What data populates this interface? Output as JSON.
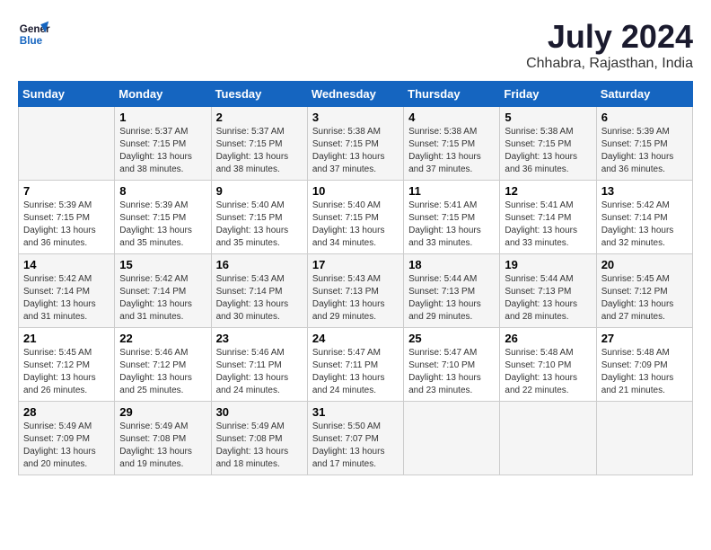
{
  "logo": {
    "line1": "General",
    "line2": "Blue"
  },
  "title": "July 2024",
  "subtitle": "Chhabra, Rajasthan, India",
  "headers": [
    "Sunday",
    "Monday",
    "Tuesday",
    "Wednesday",
    "Thursday",
    "Friday",
    "Saturday"
  ],
  "weeks": [
    [
      {
        "day": "",
        "sunrise": "",
        "sunset": "",
        "daylight": ""
      },
      {
        "day": "1",
        "sunrise": "Sunrise: 5:37 AM",
        "sunset": "Sunset: 7:15 PM",
        "daylight": "Daylight: 13 hours and 38 minutes."
      },
      {
        "day": "2",
        "sunrise": "Sunrise: 5:37 AM",
        "sunset": "Sunset: 7:15 PM",
        "daylight": "Daylight: 13 hours and 38 minutes."
      },
      {
        "day": "3",
        "sunrise": "Sunrise: 5:38 AM",
        "sunset": "Sunset: 7:15 PM",
        "daylight": "Daylight: 13 hours and 37 minutes."
      },
      {
        "day": "4",
        "sunrise": "Sunrise: 5:38 AM",
        "sunset": "Sunset: 7:15 PM",
        "daylight": "Daylight: 13 hours and 37 minutes."
      },
      {
        "day": "5",
        "sunrise": "Sunrise: 5:38 AM",
        "sunset": "Sunset: 7:15 PM",
        "daylight": "Daylight: 13 hours and 36 minutes."
      },
      {
        "day": "6",
        "sunrise": "Sunrise: 5:39 AM",
        "sunset": "Sunset: 7:15 PM",
        "daylight": "Daylight: 13 hours and 36 minutes."
      }
    ],
    [
      {
        "day": "7",
        "sunrise": "Sunrise: 5:39 AM",
        "sunset": "Sunset: 7:15 PM",
        "daylight": "Daylight: 13 hours and 36 minutes."
      },
      {
        "day": "8",
        "sunrise": "Sunrise: 5:39 AM",
        "sunset": "Sunset: 7:15 PM",
        "daylight": "Daylight: 13 hours and 35 minutes."
      },
      {
        "day": "9",
        "sunrise": "Sunrise: 5:40 AM",
        "sunset": "Sunset: 7:15 PM",
        "daylight": "Daylight: 13 hours and 35 minutes."
      },
      {
        "day": "10",
        "sunrise": "Sunrise: 5:40 AM",
        "sunset": "Sunset: 7:15 PM",
        "daylight": "Daylight: 13 hours and 34 minutes."
      },
      {
        "day": "11",
        "sunrise": "Sunrise: 5:41 AM",
        "sunset": "Sunset: 7:15 PM",
        "daylight": "Daylight: 13 hours and 33 minutes."
      },
      {
        "day": "12",
        "sunrise": "Sunrise: 5:41 AM",
        "sunset": "Sunset: 7:14 PM",
        "daylight": "Daylight: 13 hours and 33 minutes."
      },
      {
        "day": "13",
        "sunrise": "Sunrise: 5:42 AM",
        "sunset": "Sunset: 7:14 PM",
        "daylight": "Daylight: 13 hours and 32 minutes."
      }
    ],
    [
      {
        "day": "14",
        "sunrise": "Sunrise: 5:42 AM",
        "sunset": "Sunset: 7:14 PM",
        "daylight": "Daylight: 13 hours and 31 minutes."
      },
      {
        "day": "15",
        "sunrise": "Sunrise: 5:42 AM",
        "sunset": "Sunset: 7:14 PM",
        "daylight": "Daylight: 13 hours and 31 minutes."
      },
      {
        "day": "16",
        "sunrise": "Sunrise: 5:43 AM",
        "sunset": "Sunset: 7:14 PM",
        "daylight": "Daylight: 13 hours and 30 minutes."
      },
      {
        "day": "17",
        "sunrise": "Sunrise: 5:43 AM",
        "sunset": "Sunset: 7:13 PM",
        "daylight": "Daylight: 13 hours and 29 minutes."
      },
      {
        "day": "18",
        "sunrise": "Sunrise: 5:44 AM",
        "sunset": "Sunset: 7:13 PM",
        "daylight": "Daylight: 13 hours and 29 minutes."
      },
      {
        "day": "19",
        "sunrise": "Sunrise: 5:44 AM",
        "sunset": "Sunset: 7:13 PM",
        "daylight": "Daylight: 13 hours and 28 minutes."
      },
      {
        "day": "20",
        "sunrise": "Sunrise: 5:45 AM",
        "sunset": "Sunset: 7:12 PM",
        "daylight": "Daylight: 13 hours and 27 minutes."
      }
    ],
    [
      {
        "day": "21",
        "sunrise": "Sunrise: 5:45 AM",
        "sunset": "Sunset: 7:12 PM",
        "daylight": "Daylight: 13 hours and 26 minutes."
      },
      {
        "day": "22",
        "sunrise": "Sunrise: 5:46 AM",
        "sunset": "Sunset: 7:12 PM",
        "daylight": "Daylight: 13 hours and 25 minutes."
      },
      {
        "day": "23",
        "sunrise": "Sunrise: 5:46 AM",
        "sunset": "Sunset: 7:11 PM",
        "daylight": "Daylight: 13 hours and 24 minutes."
      },
      {
        "day": "24",
        "sunrise": "Sunrise: 5:47 AM",
        "sunset": "Sunset: 7:11 PM",
        "daylight": "Daylight: 13 hours and 24 minutes."
      },
      {
        "day": "25",
        "sunrise": "Sunrise: 5:47 AM",
        "sunset": "Sunset: 7:10 PM",
        "daylight": "Daylight: 13 hours and 23 minutes."
      },
      {
        "day": "26",
        "sunrise": "Sunrise: 5:48 AM",
        "sunset": "Sunset: 7:10 PM",
        "daylight": "Daylight: 13 hours and 22 minutes."
      },
      {
        "day": "27",
        "sunrise": "Sunrise: 5:48 AM",
        "sunset": "Sunset: 7:09 PM",
        "daylight": "Daylight: 13 hours and 21 minutes."
      }
    ],
    [
      {
        "day": "28",
        "sunrise": "Sunrise: 5:49 AM",
        "sunset": "Sunset: 7:09 PM",
        "daylight": "Daylight: 13 hours and 20 minutes."
      },
      {
        "day": "29",
        "sunrise": "Sunrise: 5:49 AM",
        "sunset": "Sunset: 7:08 PM",
        "daylight": "Daylight: 13 hours and 19 minutes."
      },
      {
        "day": "30",
        "sunrise": "Sunrise: 5:49 AM",
        "sunset": "Sunset: 7:08 PM",
        "daylight": "Daylight: 13 hours and 18 minutes."
      },
      {
        "day": "31",
        "sunrise": "Sunrise: 5:50 AM",
        "sunset": "Sunset: 7:07 PM",
        "daylight": "Daylight: 13 hours and 17 minutes."
      },
      {
        "day": "",
        "sunrise": "",
        "sunset": "",
        "daylight": ""
      },
      {
        "day": "",
        "sunrise": "",
        "sunset": "",
        "daylight": ""
      },
      {
        "day": "",
        "sunrise": "",
        "sunset": "",
        "daylight": ""
      }
    ]
  ]
}
